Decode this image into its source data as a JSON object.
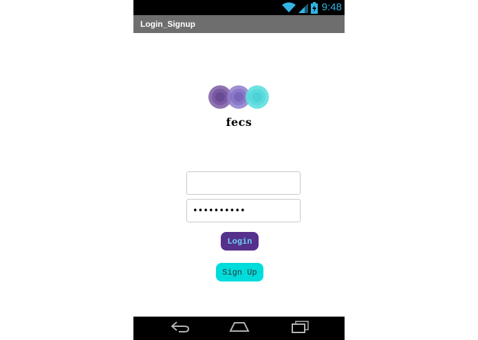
{
  "status_bar": {
    "time": "9:48",
    "icons": [
      "wifi-icon",
      "signal-icon",
      "battery-icon"
    ],
    "accent_color": "#33b5e5"
  },
  "action_bar": {
    "title": "Login_Signup"
  },
  "logo": {
    "text": "fecs",
    "colors": [
      "#7a5aa6",
      "#8e7ccc",
      "#5ee0e0"
    ]
  },
  "form": {
    "username_value": "",
    "password_value": "••••••••••",
    "login_label": "Login",
    "signup_label": "Sign Up"
  },
  "colors": {
    "login_bg": "#55308d",
    "login_text": "#6ad3f0",
    "signup_bg": "#00dcdc",
    "action_bar_bg": "#6e6e6e"
  },
  "nav_bar": {
    "icons": [
      "back-icon",
      "home-icon",
      "recent-apps-icon"
    ]
  }
}
